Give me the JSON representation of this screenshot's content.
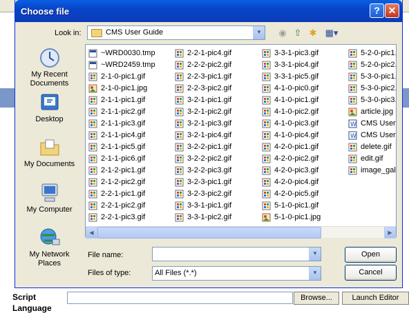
{
  "dialog": {
    "title": "Choose file",
    "look_in_label": "Look in:",
    "look_in_value": "CMS User Guide",
    "places": [
      {
        "label": "My Recent Documents",
        "icon": "recent-documents-icon"
      },
      {
        "label": "Desktop",
        "icon": "desktop-icon"
      },
      {
        "label": "My Documents",
        "icon": "my-documents-icon"
      },
      {
        "label": "My Computer",
        "icon": "my-computer-icon"
      },
      {
        "label": "My Network Places",
        "icon": "network-places-icon"
      }
    ],
    "file_name_label": "File name:",
    "file_name_value": "",
    "files_of_type_label": "Files of type:",
    "files_of_type_value": "All Files (*.*)",
    "open_label": "Open",
    "cancel_label": "Cancel"
  },
  "files": {
    "col1": [
      "~WRD0030.tmp",
      "~WRD2459.tmp",
      "2-1-0-pic1.gif",
      "2-1-0-pic1.jpg",
      "2-1-1-pic1.gif",
      "2-1-1-pic2.gif",
      "2-1-1-pic3.gif",
      "2-1-1-pic4.gif",
      "2-1-1-pic5.gif",
      "2-1-1-pic6.gif",
      "2-1-2-pic1.gif",
      "2-1-2-pic2.gif",
      "2-2-1-pic1.gif",
      "2-2-1-pic2.gif",
      "2-2-1-pic3.gif"
    ],
    "col2": [
      "2-2-1-pic4.gif",
      "2-2-2-pic2.gif",
      "2-2-3-pic1.gif",
      "2-2-3-pic2.gif",
      "3-2-1-pic1.gif",
      "3-2-1-pic2.gif",
      "3-2-1-pic3.gif",
      "3-2-1-pic4.gif",
      "3-2-2-pic1.gif",
      "3-2-2-pic2.gif",
      "3-2-2-pic3.gif",
      "3-2-3-pic1.gif",
      "3-2-3-pic2.gif",
      "3-3-1-pic1.gif",
      "3-3-1-pic2.gif"
    ],
    "col3": [
      "3-3-1-pic3.gif",
      "3-3-1-pic4.gif",
      "3-3-1-pic5.gif",
      "4-1-0-pic0.gif",
      "4-1-0-pic1.gif",
      "4-1-0-pic2.gif",
      "4-1-0-pic3.gif",
      "4-1-0-pic4.gif",
      "4-2-0-pic1.gif",
      "4-2-0-pic2.gif",
      "4-2-0-pic3.gif",
      "4-2-0-pic4.gif",
      "4-2-0-pic5.gif",
      "5-1-0-pic1.gif",
      "5-1-0-pic1.jpg"
    ],
    "col4": [
      "5-2-0-pic1.",
      "5-2-0-pic2.",
      "5-3-0-pic1.",
      "5-3-0-pic2.",
      "5-3-0-pic3.",
      "article.jpg",
      "CMS User G",
      "CMS User G",
      "delete.gif",
      "edit.gif",
      "image_galle"
    ]
  },
  "background": {
    "script_label": "Script",
    "language_label": "Language",
    "browse_label": "Browse...",
    "launch_label": "Launch Editor"
  },
  "colors": {
    "titlebar": "#0a5fe3",
    "dialog_bg": "#ece9d8"
  }
}
